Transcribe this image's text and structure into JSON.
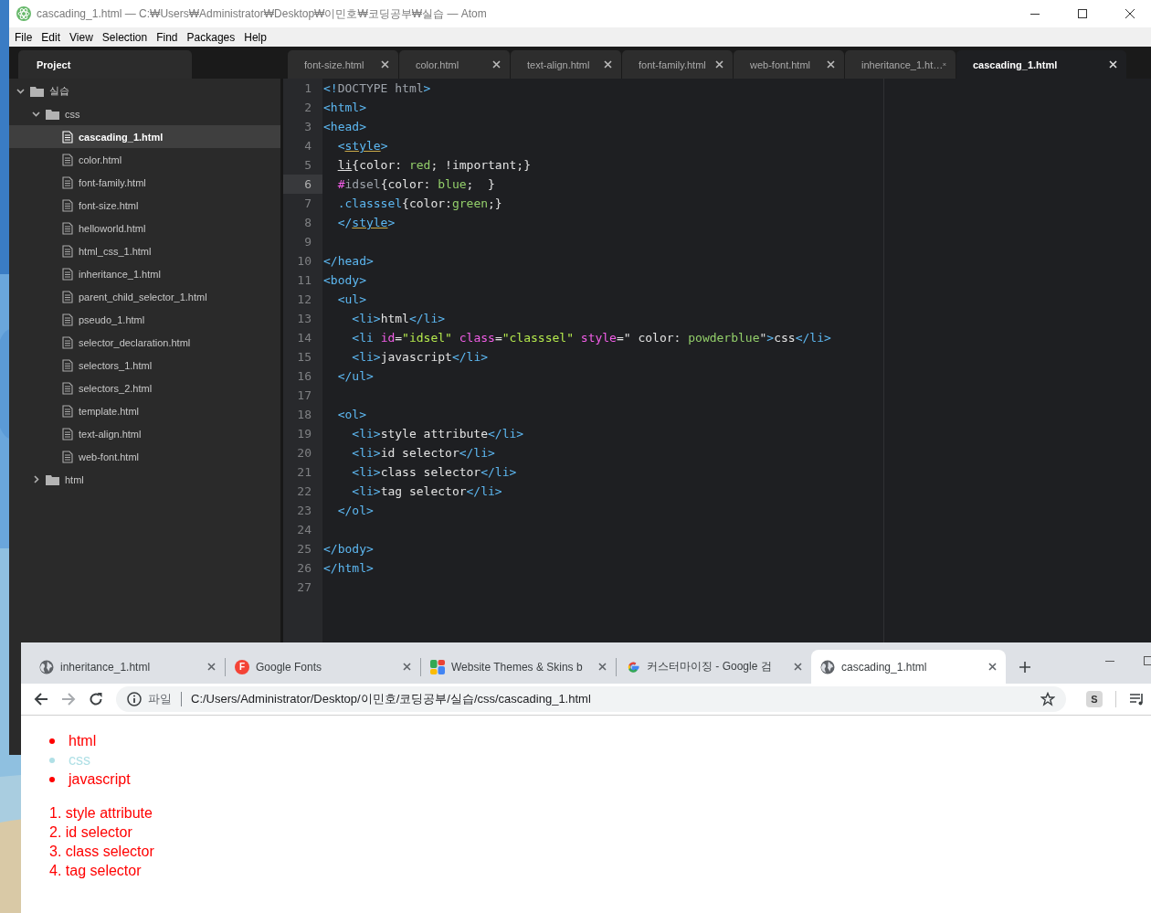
{
  "atom": {
    "title": "cascading_1.html — C:₩Users₩Administrator₩Desktop₩이민호₩코딩공부₩실습 — Atom",
    "menu": [
      "File",
      "Edit",
      "View",
      "Selection",
      "Find",
      "Packages",
      "Help"
    ],
    "project_tab": "Project",
    "tabs": [
      {
        "label": "font-size.html",
        "selected": false
      },
      {
        "label": "color.html",
        "selected": false
      },
      {
        "label": "text-align.html",
        "selected": false
      },
      {
        "label": "font-family.html",
        "selected": false
      },
      {
        "label": "web-font.html",
        "selected": false
      },
      {
        "label": "inheritance_1.ht…",
        "selected": false
      },
      {
        "label": "cascading_1.html",
        "selected": true
      }
    ],
    "tree": [
      {
        "kind": "folder",
        "name": "실습",
        "expanded": true,
        "children": [
          {
            "kind": "folder",
            "name": "css",
            "expanded": true,
            "children": [
              {
                "kind": "file",
                "name": "cascading_1.html",
                "selected": true
              },
              {
                "kind": "file",
                "name": "color.html",
                "selected": false
              },
              {
                "kind": "file",
                "name": "font-family.html",
                "selected": false
              },
              {
                "kind": "file",
                "name": "font-size.html",
                "selected": false
              },
              {
                "kind": "file",
                "name": "helloworld.html",
                "selected": false
              },
              {
                "kind": "file",
                "name": "html_css_1.html",
                "selected": false
              },
              {
                "kind": "file",
                "name": "inheritance_1.html",
                "selected": false
              },
              {
                "kind": "file",
                "name": "parent_child_selector_1.html",
                "selected": false
              },
              {
                "kind": "file",
                "name": "pseudo_1.html",
                "selected": false
              },
              {
                "kind": "file",
                "name": "selector_declaration.html",
                "selected": false
              },
              {
                "kind": "file",
                "name": "selectors_1.html",
                "selected": false
              },
              {
                "kind": "file",
                "name": "selectors_2.html",
                "selected": false
              },
              {
                "kind": "file",
                "name": "template.html",
                "selected": false
              },
              {
                "kind": "file",
                "name": "text-align.html",
                "selected": false
              },
              {
                "kind": "file",
                "name": "web-font.html",
                "selected": false
              }
            ]
          },
          {
            "kind": "folder",
            "name": "html",
            "expanded": false
          }
        ]
      }
    ],
    "code": [
      {
        "number": "1",
        "current": false,
        "tokens": [
          {
            "kind": "tag",
            "text": "<!"
          },
          {
            "kind": "dim",
            "text": "DOCTYPE html"
          },
          {
            "kind": "tag",
            "text": ">"
          }
        ]
      },
      {
        "number": "2",
        "current": false,
        "tokens": [
          {
            "kind": "tag",
            "text": "<html>"
          }
        ]
      },
      {
        "number": "3",
        "current": false,
        "tokens": [
          {
            "kind": "tag",
            "text": "<head>"
          }
        ]
      },
      {
        "number": "4",
        "current": false,
        "tokens": [
          {
            "kind": "tag",
            "text": "  <"
          },
          {
            "kind": "tagu",
            "text": "style"
          },
          {
            "kind": "tag",
            "text": ">"
          }
        ]
      },
      {
        "number": "5",
        "current": false,
        "tokens": [
          {
            "kind": "plainu",
            "text": "  li"
          },
          {
            "kind": "plain",
            "text": "{color: "
          },
          {
            "kind": "value",
            "text": "red"
          },
          {
            "kind": "plain",
            "text": "; !important;}"
          }
        ]
      },
      {
        "number": "6",
        "current": true,
        "tokens": [
          {
            "kind": "attr",
            "text": "  #"
          },
          {
            "kind": "dim",
            "text": "idsel"
          },
          {
            "kind": "plain",
            "text": "{color: "
          },
          {
            "kind": "value",
            "text": "blue"
          },
          {
            "kind": "plain",
            "text": ";  }"
          }
        ]
      },
      {
        "number": "7",
        "current": false,
        "tokens": [
          {
            "kind": "tag",
            "text": "  .classsel"
          },
          {
            "kind": "plain",
            "text": "{color:"
          },
          {
            "kind": "value",
            "text": "green"
          },
          {
            "kind": "plain",
            "text": ";}"
          }
        ]
      },
      {
        "number": "8",
        "current": false,
        "tokens": [
          {
            "kind": "tag",
            "text": "  </"
          },
          {
            "kind": "tagu",
            "text": "style"
          },
          {
            "kind": "tag",
            "text": ">"
          }
        ]
      },
      {
        "number": "9",
        "current": false
      },
      {
        "number": "10",
        "current": false,
        "tokens": [
          {
            "kind": "tag",
            "text": "</head>"
          }
        ]
      },
      {
        "number": "11",
        "current": false,
        "tokens": [
          {
            "kind": "tag",
            "text": "<body>"
          }
        ]
      },
      {
        "number": "12",
        "current": false,
        "tokens": [
          {
            "kind": "tag",
            "text": "  <ul>"
          }
        ]
      },
      {
        "number": "13",
        "current": false,
        "tokens": [
          {
            "kind": "tag",
            "text": "    <li>"
          },
          {
            "kind": "plain",
            "text": "html"
          },
          {
            "kind": "tag",
            "text": "</li>"
          }
        ]
      },
      {
        "number": "14",
        "current": false,
        "tokens": [
          {
            "kind": "tag",
            "text": "    <li "
          },
          {
            "kind": "attr",
            "text": "id"
          },
          {
            "kind": "plain",
            "text": "="
          },
          {
            "kind": "string",
            "text": "\"idsel\""
          },
          {
            "kind": "attr",
            "text": " class"
          },
          {
            "kind": "plain",
            "text": "="
          },
          {
            "kind": "string",
            "text": "\"classsel\""
          },
          {
            "kind": "attr",
            "text": " style"
          },
          {
            "kind": "plain",
            "text": "=\" color: "
          },
          {
            "kind": "value",
            "text": "powderblue"
          },
          {
            "kind": "plain",
            "text": "\""
          },
          {
            "kind": "tag",
            "text": ">"
          },
          {
            "kind": "plain",
            "text": "css"
          },
          {
            "kind": "tag",
            "text": "</li>"
          }
        ]
      },
      {
        "number": "15",
        "current": false,
        "tokens": [
          {
            "kind": "tag",
            "text": "    <li>"
          },
          {
            "kind": "plain",
            "text": "javascript"
          },
          {
            "kind": "tag",
            "text": "</li>"
          }
        ]
      },
      {
        "number": "16",
        "current": false,
        "tokens": [
          {
            "kind": "tag",
            "text": "  </ul>"
          }
        ]
      },
      {
        "number": "17",
        "current": false
      },
      {
        "number": "18",
        "current": false,
        "tokens": [
          {
            "kind": "tag",
            "text": "  <ol>"
          }
        ]
      },
      {
        "number": "19",
        "current": false,
        "tokens": [
          {
            "kind": "tag",
            "text": "    <li>"
          },
          {
            "kind": "plain",
            "text": "style attribute"
          },
          {
            "kind": "tag",
            "text": "</li>"
          }
        ]
      },
      {
        "number": "20",
        "current": false,
        "tokens": [
          {
            "kind": "tag",
            "text": "    <li>"
          },
          {
            "kind": "plain",
            "text": "id selector"
          },
          {
            "kind": "tag",
            "text": "</li>"
          }
        ]
      },
      {
        "number": "21",
        "current": false,
        "tokens": [
          {
            "kind": "tag",
            "text": "    <li>"
          },
          {
            "kind": "plain",
            "text": "class selector"
          },
          {
            "kind": "tag",
            "text": "</li>"
          }
        ]
      },
      {
        "number": "22",
        "current": false,
        "tokens": [
          {
            "kind": "tag",
            "text": "    <li>"
          },
          {
            "kind": "plain",
            "text": "tag selector"
          },
          {
            "kind": "tag",
            "text": "</li>"
          }
        ]
      },
      {
        "number": "23",
        "current": false,
        "tokens": [
          {
            "kind": "tag",
            "text": "  </ol>"
          }
        ]
      },
      {
        "number": "24",
        "current": false
      },
      {
        "number": "25",
        "current": false,
        "tokens": [
          {
            "kind": "tag",
            "text": "</body>"
          }
        ]
      },
      {
        "number": "26",
        "current": false,
        "tokens": [
          {
            "kind": "tag",
            "text": "</html>"
          }
        ]
      },
      {
        "number": "27",
        "current": false
      }
    ]
  },
  "browser": {
    "tabs": [
      {
        "kind": "globe",
        "title": "inheritance_1.html",
        "selected": false
      },
      {
        "kind": "fonts",
        "icon_text": "F",
        "title": "Google Fonts",
        "selected": false
      },
      {
        "kind": "themes",
        "title": "Website Themes & Skins b",
        "selected": false
      },
      {
        "kind": "google",
        "title": "커스터마이징 - Google 검",
        "selected": false
      },
      {
        "kind": "globe",
        "title": "cascading_1.html",
        "selected": true
      }
    ],
    "address": {
      "scheme_label": "파일",
      "url": "C:/Users/Administrator/Desktop/이민호/코딩공부/실습/css/cascading_1.html"
    },
    "extension_text": "S",
    "page": {
      "ul": [
        {
          "text": "html",
          "color": "#ff0000"
        },
        {
          "text": "css",
          "color": "#b0e0e6"
        },
        {
          "text": "javascript",
          "color": "#ff0000"
        }
      ],
      "ol": [
        {
          "marker": "1.",
          "text": "style attribute"
        },
        {
          "marker": "2.",
          "text": "id selector"
        },
        {
          "marker": "3.",
          "text": "class selector"
        },
        {
          "marker": "4.",
          "text": "tag selector"
        }
      ]
    }
  }
}
